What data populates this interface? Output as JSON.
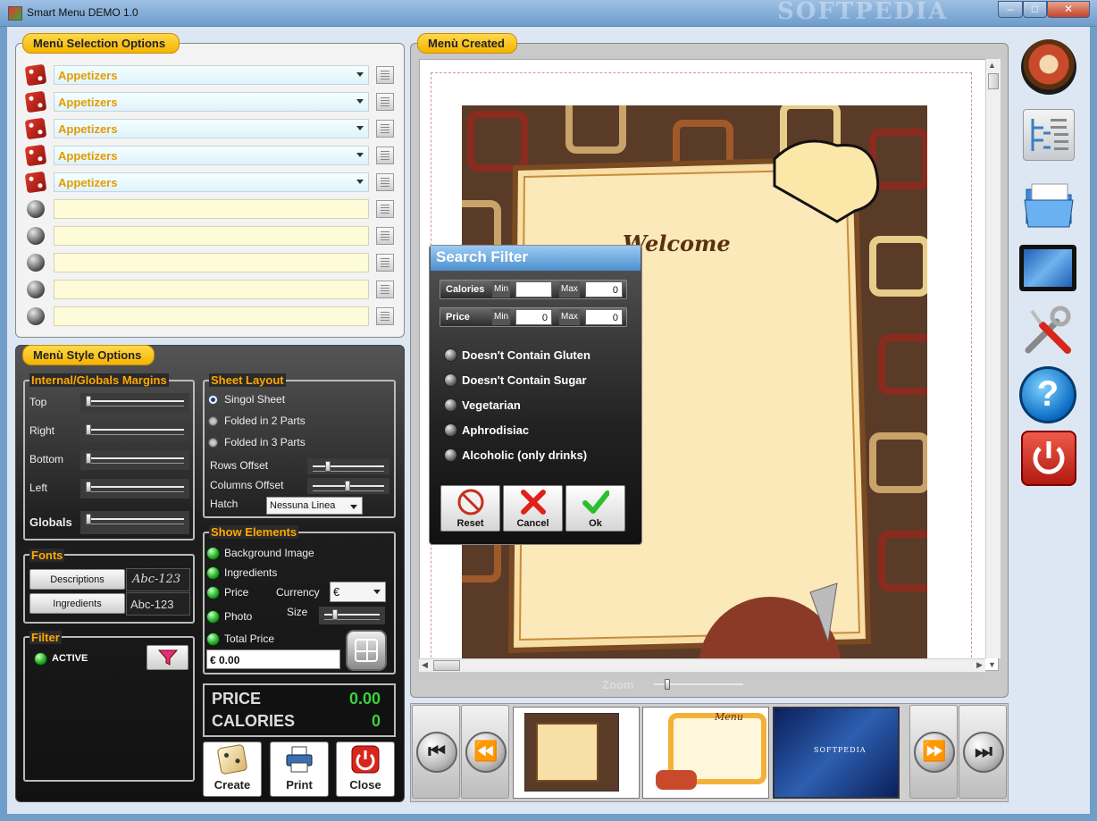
{
  "window": {
    "title": "Smart Menu DEMO 1.0",
    "watermark": "SOFTPEDIA",
    "min": "‒",
    "max": "□",
    "close": "✕"
  },
  "selection": {
    "tab": "Menù Selection Options",
    "rows": [
      {
        "value": "Appetizers",
        "active": true
      },
      {
        "value": "Appetizers",
        "active": true
      },
      {
        "value": "Appetizers",
        "active": true
      },
      {
        "value": "Appetizers",
        "active": true
      },
      {
        "value": "Appetizers",
        "active": true
      },
      {
        "value": "",
        "active": false
      },
      {
        "value": "",
        "active": false
      },
      {
        "value": "",
        "active": false
      },
      {
        "value": "",
        "active": false
      },
      {
        "value": "",
        "active": false
      }
    ]
  },
  "style": {
    "tab": "Menù Style Options",
    "margins": {
      "title": "Internal/Globals Margins",
      "top": "Top",
      "right": "Right",
      "bottom": "Bottom",
      "left": "Left",
      "globals": "Globals"
    },
    "sheet": {
      "title": "Sheet Layout",
      "single": "Singol Sheet",
      "two": "Folded in 2 Parts",
      "three": "Folded in 3 Parts",
      "rows": "Rows Offset",
      "cols": "Columns Offset",
      "hatch": "Hatch",
      "hatch_value": "Nessuna Linea"
    },
    "fonts": {
      "title": "Fonts",
      "desc_btn": "Descriptions",
      "ingr_btn": "Ingredients",
      "desc_sample": "Abc-123",
      "ingr_sample": "Abc-123"
    },
    "show": {
      "title": "Show Elements",
      "bg": "Background Image",
      "ingredients": "Ingredients",
      "price": "Price",
      "currency": "Currency",
      "currency_value": "€",
      "photo": "Photo",
      "size": "Size",
      "total": "Total Price",
      "total_value": "€ 0.00"
    },
    "filter": {
      "title": "Filter",
      "status": "ACTIVE"
    },
    "summary": {
      "price_label": "PRICE",
      "price_value": "0.00",
      "cal_label": "CALORIES",
      "cal_value": "0"
    },
    "buttons": {
      "create": "Create",
      "print": "Print",
      "close": "Close"
    }
  },
  "created": {
    "tab": "Menù Created",
    "zoom": "Zoom",
    "menu_script": "Welcome"
  },
  "dialog": {
    "title": "Search Filter",
    "calories": "Calories",
    "price": "Price",
    "min": "Min",
    "max": "Max",
    "cal_min": "",
    "cal_max": "0",
    "price_min": "0",
    "price_max": "0",
    "options": [
      "Doesn't Contain Gluten",
      "Doesn't Contain Sugar",
      "Vegetarian",
      "Aphrodisiac",
      "Alcoholic (only drinks)"
    ],
    "reset": "Reset",
    "cancel": "Cancel",
    "ok": "Ok"
  },
  "thumbs": {
    "t2_script": "Menu",
    "t3_text": "SOFTPEDIA"
  },
  "icons": [
    "app-icon",
    "dice-icon",
    "radio-ball-icon",
    "list-icon",
    "filter-funnel-icon",
    "dice-create-icon",
    "printer-icon",
    "power-icon",
    "chef-icon",
    "tree-icon",
    "folder-icon",
    "monitor-icon",
    "tools-icon",
    "help-icon",
    "first-icon",
    "prev-icon",
    "next-icon",
    "last-icon"
  ],
  "colors": {
    "accent": "#ffa800",
    "tab": "#f5b400",
    "value": "#e59b00",
    "green": "#3ad33a"
  }
}
